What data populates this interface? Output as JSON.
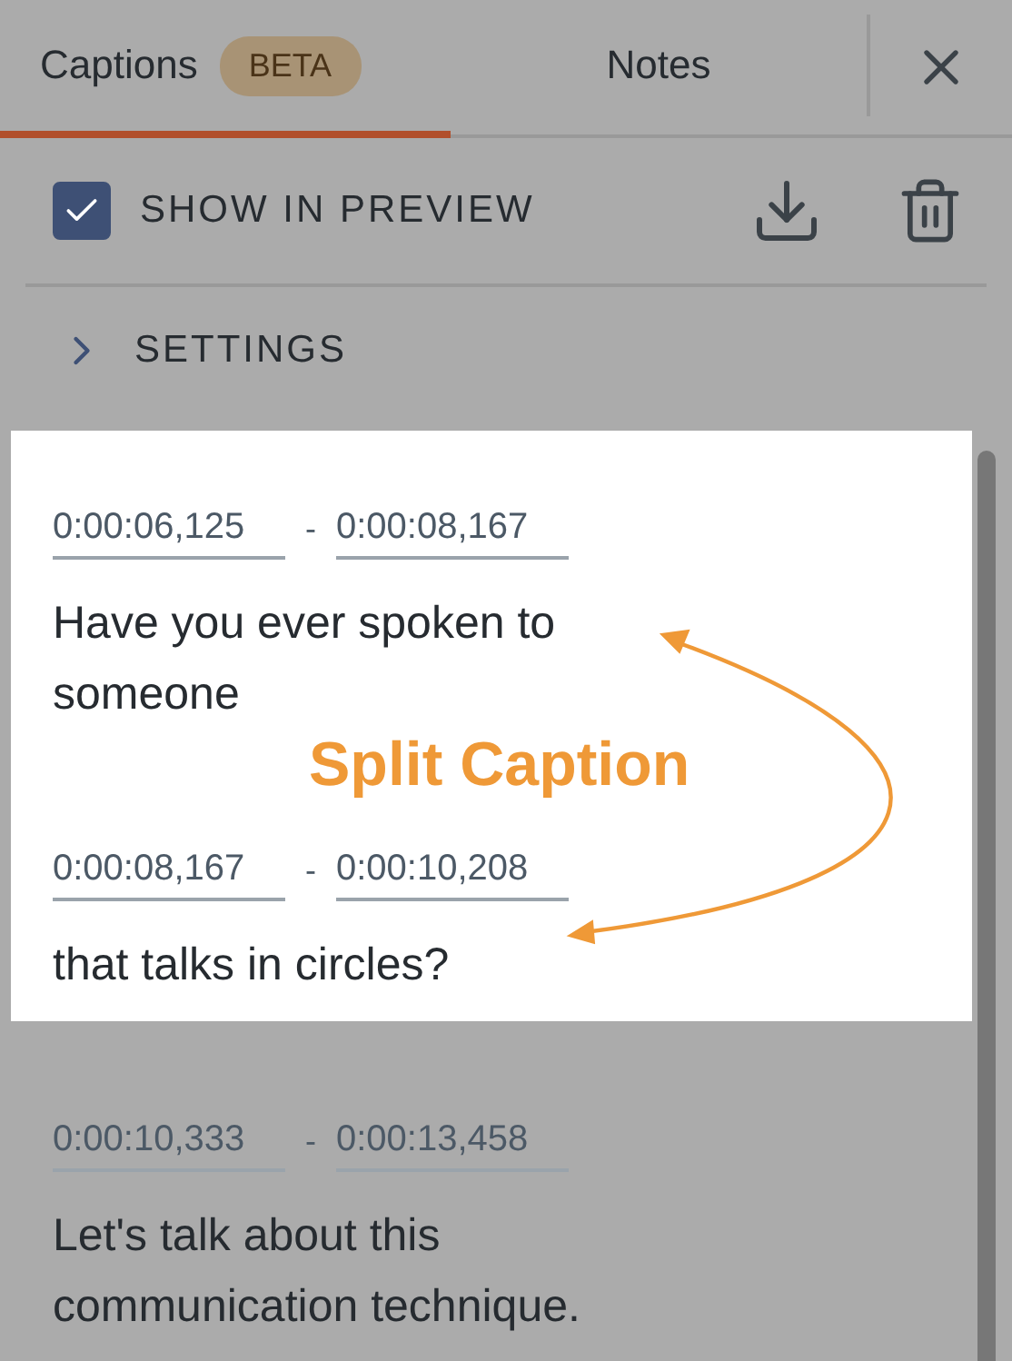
{
  "tabs": [
    {
      "label": "Captions",
      "badge": "BETA",
      "selected": true
    },
    {
      "label": "Notes",
      "selected": false
    }
  ],
  "toolbar": {
    "show_in_preview": {
      "label": "SHOW IN PREVIEW",
      "checked": true
    }
  },
  "settings": {
    "label": "SETTINGS",
    "expanded": false
  },
  "caption_groups": [
    {
      "highlighted": true,
      "annotation": "Split Caption",
      "captions": [
        {
          "start": "0:00:06,125",
          "separator": "-",
          "end": "0:00:08,167",
          "text": "Have you ever spoken to someone"
        },
        {
          "start": "0:00:08,167",
          "separator": "-",
          "end": "0:00:10,208",
          "text": "that talks in circles?"
        }
      ]
    },
    {
      "highlighted": false,
      "captions": [
        {
          "start": "0:00:10,333",
          "separator": "-",
          "end": "0:00:13,458",
          "text": "Let's talk about this communication technique."
        }
      ]
    }
  ]
}
